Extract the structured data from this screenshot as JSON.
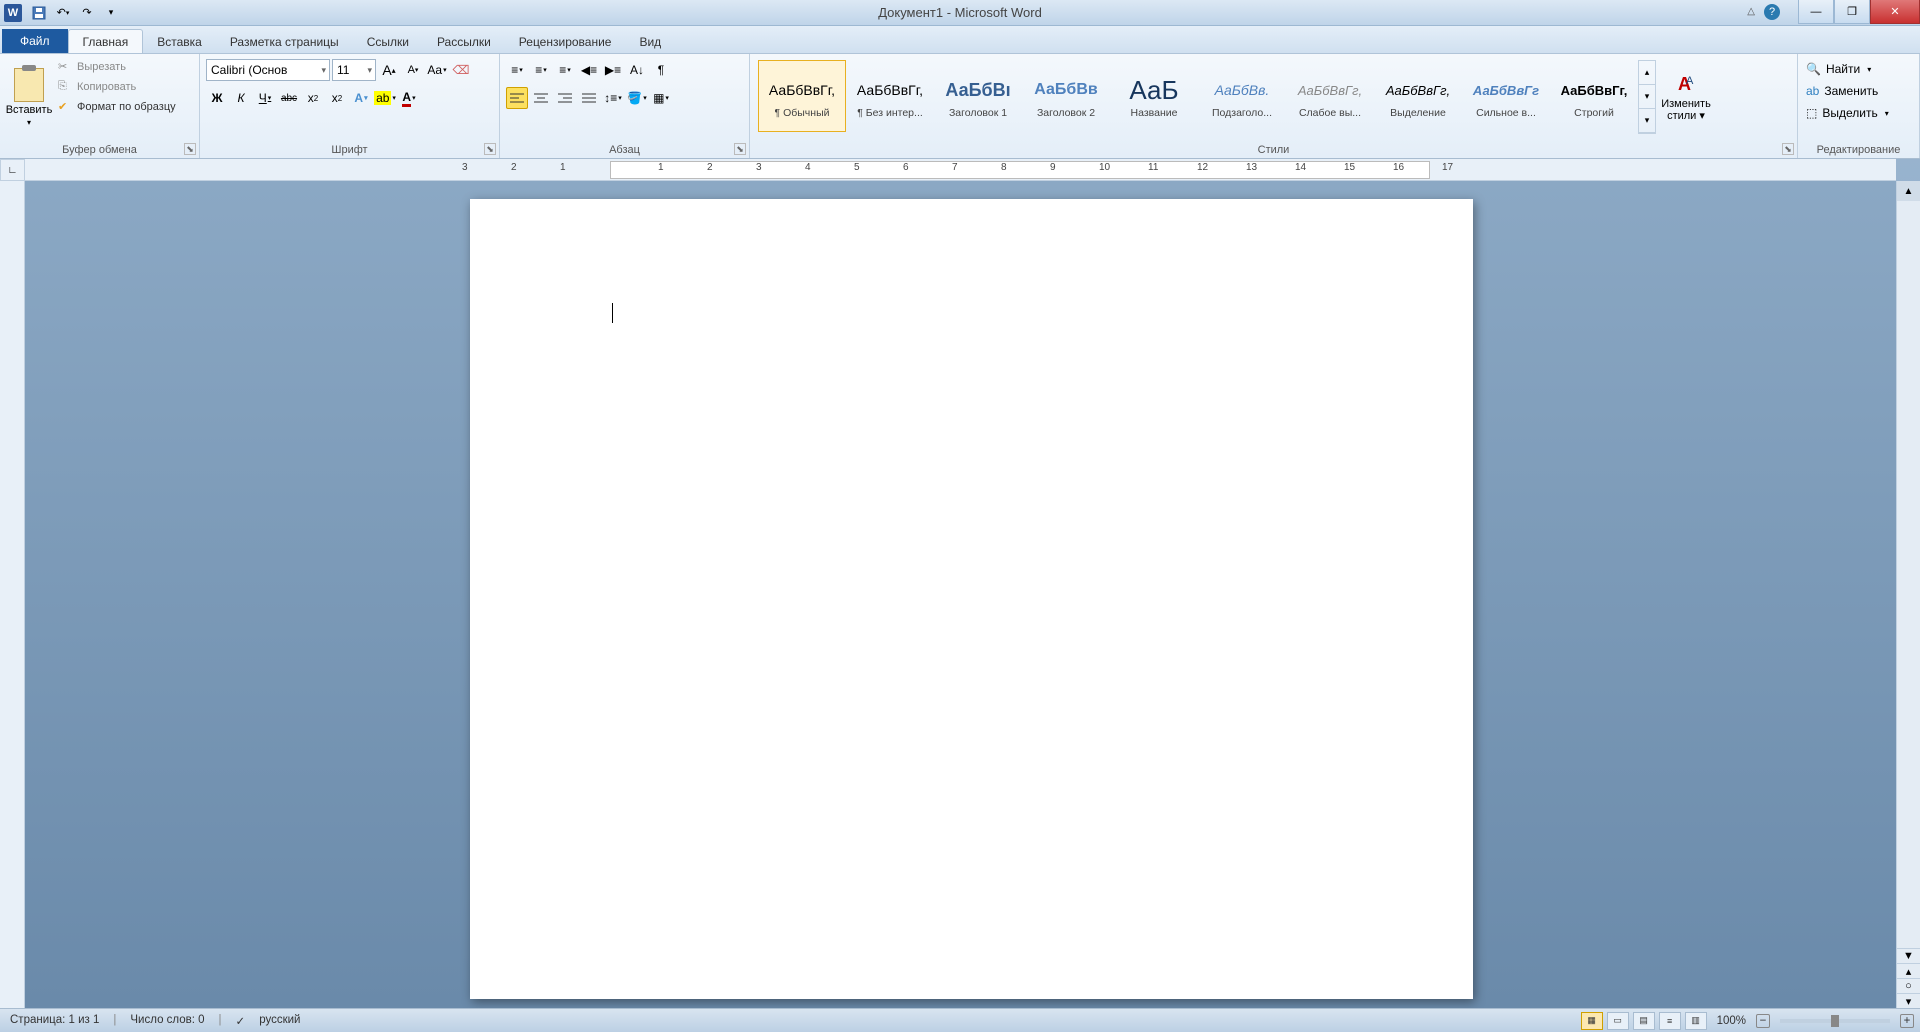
{
  "title": "Документ1 - Microsoft Word",
  "qat": {
    "save": "save",
    "undo": "undo",
    "redo": "redo"
  },
  "tabs": {
    "file": "Файл",
    "home": "Главная",
    "insert": "Вставка",
    "layout": "Разметка страницы",
    "refs": "Ссылки",
    "mail": "Рассылки",
    "review": "Рецензирование",
    "view": "Вид"
  },
  "clipboard": {
    "paste": "Вставить",
    "cut": "Вырезать",
    "copy": "Копировать",
    "format": "Формат по образцу",
    "group": "Буфер обмена"
  },
  "font": {
    "name": "Calibri (Основ",
    "size": "11",
    "group": "Шрифт",
    "grow": "A",
    "shrink": "A",
    "case": "Aa",
    "clear": "clear",
    "bold": "Ж",
    "italic": "К",
    "underline": "Ч",
    "strike": "abc",
    "sub": "x₂",
    "sup": "x²",
    "effects": "A",
    "highlight": "ab",
    "color": "A"
  },
  "para": {
    "group": "Абзац",
    "bullets": "•",
    "numbers": "1.",
    "multi": "≡",
    "dedent": "◀",
    "indent": "▶",
    "sort": "A↓",
    "marks": "¶",
    "left": "≡",
    "center": "≡",
    "right": "≡",
    "justify": "≡",
    "spacing": "↕",
    "shading": "▦",
    "borders": "▦"
  },
  "styles": {
    "group": "Стили",
    "items": [
      {
        "preview": "АаБбВвГг,",
        "name": "¶ Обычный",
        "css": "font-size:14px;"
      },
      {
        "preview": "АаБбВвГг,",
        "name": "¶ Без интер...",
        "css": "font-size:14px;"
      },
      {
        "preview": "АаБбВı",
        "name": "Заголовок 1",
        "css": "font-size:18px;color:#365f91;font-weight:bold;"
      },
      {
        "preview": "АаБбВв",
        "name": "Заголовок 2",
        "css": "font-size:16px;color:#4f81bd;font-weight:bold;"
      },
      {
        "preview": "АаБ",
        "name": "Название",
        "css": "font-size:26px;color:#17365d;"
      },
      {
        "preview": "АаБбВв.",
        "name": "Подзаголо...",
        "css": "font-size:14px;color:#4f81bd;font-style:italic;"
      },
      {
        "preview": "АаБбВвГг,",
        "name": "Слабое вы...",
        "css": "font-size:13px;color:#888;font-style:italic;"
      },
      {
        "preview": "АаБбВвГг,",
        "name": "Выделение",
        "css": "font-size:13px;font-style:italic;"
      },
      {
        "preview": "АаБбВвГг",
        "name": "Сильное в...",
        "css": "font-size:13px;color:#4f81bd;font-weight:bold;font-style:italic;"
      },
      {
        "preview": "АаБбВвГг,",
        "name": "Строгий",
        "css": "font-size:13px;font-weight:bold;"
      }
    ],
    "change": "Изменить стили"
  },
  "editing": {
    "find": "Найти",
    "replace": "Заменить",
    "select": "Выделить",
    "group": "Редактирование"
  },
  "status": {
    "page": "Страница: 1 из 1",
    "words": "Число слов: 0",
    "lang": "русский",
    "zoom": "100%"
  },
  "ruler_h": [
    "3",
    "2",
    "1",
    "",
    "1",
    "2",
    "3",
    "4",
    "5",
    "6",
    "7",
    "8",
    "9",
    "10",
    "11",
    "12",
    "13",
    "14",
    "15",
    "16",
    "17"
  ]
}
